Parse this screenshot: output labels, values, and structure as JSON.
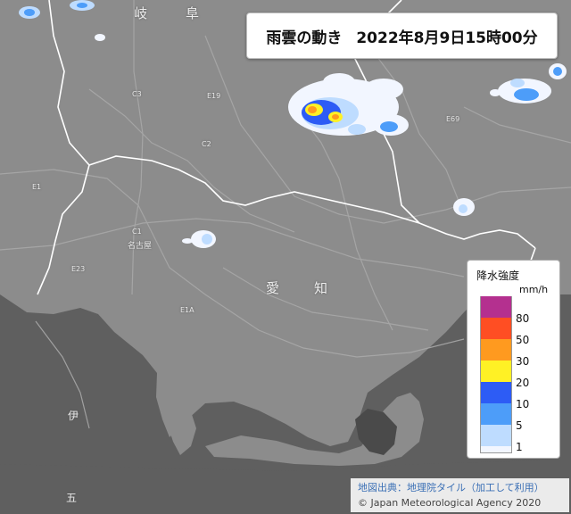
{
  "title": {
    "main": "雨雲の動き",
    "datetime": "2022年8月9日15時00分"
  },
  "map": {
    "place_labels": [
      {
        "id": "gifu-1",
        "text": "岐"
      },
      {
        "id": "gifu-2",
        "text": "阜"
      },
      {
        "id": "aichi-1",
        "text": "愛"
      },
      {
        "id": "aichi-2",
        "text": "知"
      },
      {
        "id": "nagoya",
        "text": "名古屋"
      },
      {
        "id": "ise",
        "text": "伊"
      },
      {
        "id": "go",
        "text": "五"
      }
    ],
    "road_shields": [
      "C3",
      "C2",
      "C1",
      "E1",
      "E1A",
      "E19",
      "E69",
      "E23"
    ]
  },
  "legend": {
    "title": "降水強度",
    "unit": "mm/h",
    "levels": [
      {
        "label": "80",
        "color": "#b4308f"
      },
      {
        "label": "50",
        "color": "#ff4e23"
      },
      {
        "label": "30",
        "color": "#ff9a1f"
      },
      {
        "label": "20",
        "color": "#fff125"
      },
      {
        "label": "10",
        "color": "#2d5cf5"
      },
      {
        "label": "5",
        "color": "#4d9df9"
      },
      {
        "label": "1",
        "color": "#bedcff"
      },
      {
        "label": "",
        "color": "#f2f6ff"
      }
    ]
  },
  "credits": {
    "map_source": "地図出典：地理院タイル（加工して利用）",
    "copyright": "© Japan Meteorological Agency 2020"
  },
  "colors": {
    "land": "#8c8c8c",
    "sea": "#5f5f5f",
    "boundary": "#ffffff",
    "road": "#a3a3a3"
  }
}
